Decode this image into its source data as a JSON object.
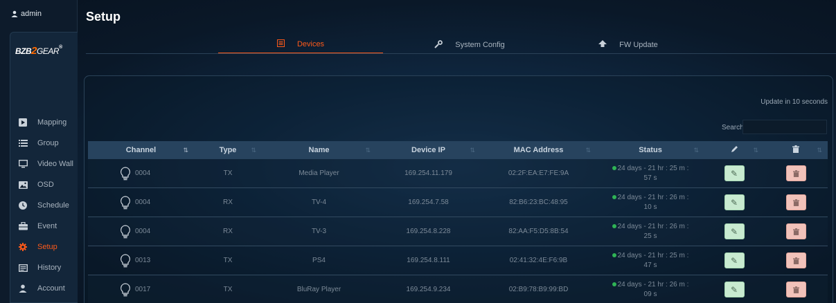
{
  "user": {
    "name": "admin",
    "icon": "person-icon"
  },
  "logo": {
    "part1": "BZB",
    "part2": "2",
    "part3": "GEAR",
    "mark": "®"
  },
  "page_title": "Setup",
  "tabs": [
    {
      "label": "Devices",
      "icon": "list-icon",
      "active": true
    },
    {
      "label": "System Config",
      "icon": "wrench-icon",
      "active": false
    },
    {
      "label": "FW Update",
      "icon": "upload-icon",
      "active": false
    }
  ],
  "sidebar": {
    "items": [
      {
        "label": "Mapping",
        "icon": "play-square-icon"
      },
      {
        "label": "Group",
        "icon": "list-icon"
      },
      {
        "label": "Video Wall",
        "icon": "monitor-icon"
      },
      {
        "label": "OSD",
        "icon": "image-icon"
      },
      {
        "label": "Schedule",
        "icon": "clock-icon"
      },
      {
        "label": "Event",
        "icon": "briefcase-icon"
      },
      {
        "label": "Setup",
        "icon": "gear-icon",
        "active": true
      },
      {
        "label": "History",
        "icon": "log-icon"
      },
      {
        "label": "Account",
        "icon": "person-icon"
      }
    ]
  },
  "update_notice": "Update in 10 seconds",
  "search": {
    "label": "Search:",
    "value": ""
  },
  "table": {
    "headers": [
      "Channel",
      "Type",
      "Name",
      "Device IP",
      "MAC Address",
      "Status",
      "",
      ""
    ],
    "rows": [
      {
        "channel": "0004",
        "type": "TX",
        "name": "Media Player",
        "ip": "169.254.11.179",
        "mac": "02:2F:EA:E7:FE:9A",
        "status_line1": "24 days - 21 hr : 25 m :",
        "status_line2": "57 s"
      },
      {
        "channel": "0004",
        "type": "RX",
        "name": "TV-4",
        "ip": "169.254.7.58",
        "mac": "82:B6:23:BC:48:95",
        "status_line1": "24 days - 21 hr : 26 m :",
        "status_line2": "10 s"
      },
      {
        "channel": "0004",
        "type": "RX",
        "name": "TV-3",
        "ip": "169.254.8.228",
        "mac": "82:AA:F5:D5:8B:54",
        "status_line1": "24 days - 21 hr : 26 m :",
        "status_line2": "25 s"
      },
      {
        "channel": "0013",
        "type": "TX",
        "name": "PS4",
        "ip": "169.254.8.111",
        "mac": "02:41:32:4E:F6:9B",
        "status_line1": "24 days - 21 hr : 25 m :",
        "status_line2": "47 s"
      },
      {
        "channel": "0017",
        "type": "TX",
        "name": "BluRay Player",
        "ip": "169.254.9.234",
        "mac": "02:B9:78:B9:99:BD",
        "status_line1": "24 days - 21 hr : 26 m :",
        "status_line2": "09 s"
      }
    ]
  },
  "colors": {
    "accent": "#ff5a1a",
    "online": "#2fb355",
    "header_bg": "#27435e"
  }
}
